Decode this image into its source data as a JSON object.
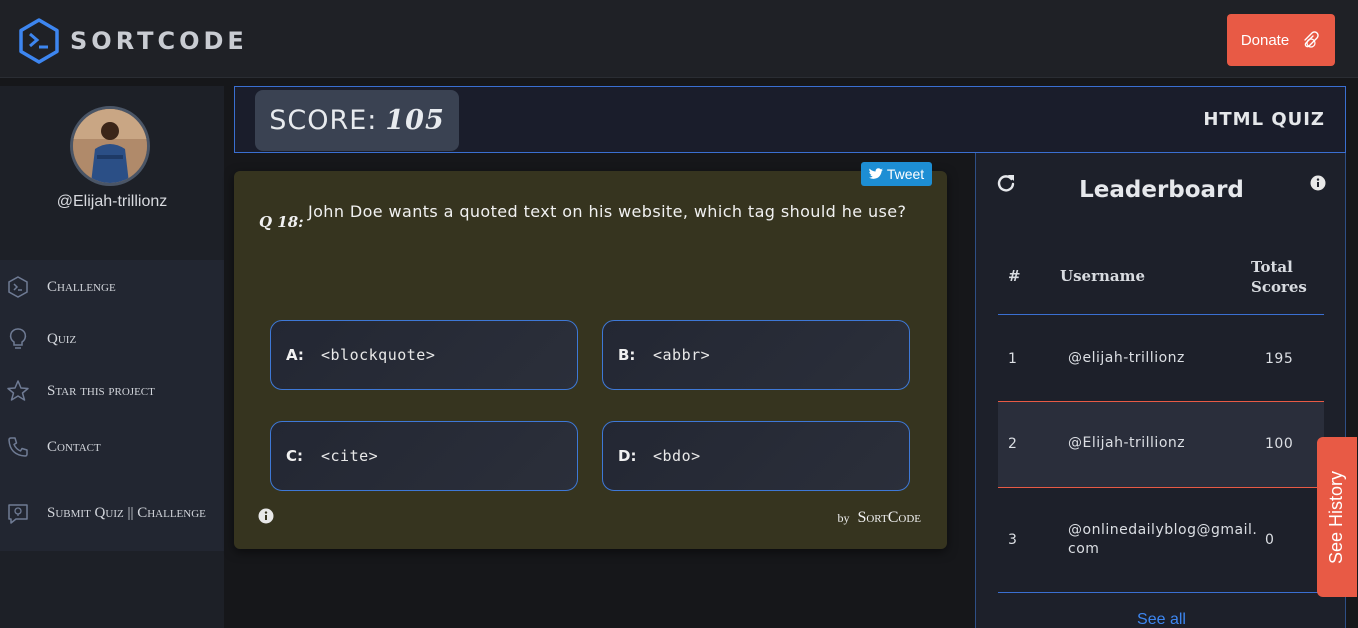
{
  "brand": {
    "name": "SORTCODE"
  },
  "header": {
    "donate_label": "Donate"
  },
  "profile": {
    "username": "@Elijah-trillionz"
  },
  "sidebar": {
    "items": [
      {
        "label": "Challenge",
        "icon": "terminal-hex-icon"
      },
      {
        "label": "Quiz",
        "icon": "lightbulb-icon"
      },
      {
        "label": "Star this project",
        "icon": "star-icon"
      },
      {
        "label": "Contact",
        "icon": "phone-icon"
      },
      {
        "label": "Submit Quiz || Challenge",
        "icon": "idea-bubble-icon"
      }
    ]
  },
  "score": {
    "label": "SCORE:",
    "value": "105"
  },
  "quiz": {
    "title": "HTML QUIZ"
  },
  "question": {
    "tweet_label": "Tweet",
    "number": "Q 18:",
    "text": "John Doe wants a quoted text on his website, which tag should he use?",
    "options": [
      {
        "key": "A:",
        "value": "<blockquote>"
      },
      {
        "key": "B:",
        "value": "<abbr>"
      },
      {
        "key": "C:",
        "value": "<cite>"
      },
      {
        "key": "D:",
        "value": "<bdo>"
      }
    ],
    "by": "by",
    "credit": "SortCode"
  },
  "leaderboard": {
    "title": "Leaderboard",
    "columns": {
      "rank": "#",
      "username": "Username",
      "total": "Total Scores"
    },
    "rows": [
      {
        "rank": "1",
        "username": "@elijah-trillionz",
        "score": "195"
      },
      {
        "rank": "2",
        "username": "@Elijah-trillionz",
        "score": "100"
      },
      {
        "rank": "3",
        "username": "@onlinedailyblog@gmail.com",
        "score": "0"
      }
    ],
    "see_all": "See all"
  },
  "history": {
    "label": "See History"
  },
  "colors": {
    "accent": "#e85a45",
    "border_blue": "#3a6fd1",
    "card_bg": "#36341f",
    "link": "#3d86f0"
  }
}
